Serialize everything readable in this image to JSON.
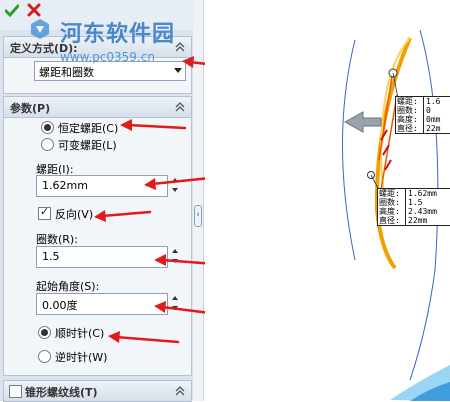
{
  "panel": {
    "definition_group": {
      "title": "定义方式(D):",
      "selected": "螺距和圈数"
    },
    "params_group": {
      "title": "参数(P)",
      "constant_pitch_label": "恒定螺距(C)",
      "variable_pitch_label": "可变螺距(L)",
      "pitch_label": "螺距(I):",
      "pitch_value": "1.62mm",
      "reverse_label": "反向(V)",
      "revolutions_label": "圈数(R):",
      "revolutions_value": "1.5",
      "start_angle_label": "起始角度(S):",
      "start_angle_value": "0.00度",
      "clockwise_label": "顺时针(C)",
      "counterclockwise_label": "逆时针(W)"
    },
    "taper_group": {
      "title": "锥形螺纹线(T)"
    }
  },
  "watermark": {
    "name": "河东软件园",
    "url": "www.pc0359.cn"
  },
  "viewport": {
    "callout_top": {
      "rows": [
        {
          "k": "螺距:",
          "v": "1.6"
        },
        {
          "k": "圈数:",
          "v": "0"
        },
        {
          "k": "高度:",
          "v": "0mm"
        },
        {
          "k": "直径:",
          "v": "22m"
        }
      ]
    },
    "callout_bottom": {
      "rows": [
        {
          "k": "螺距:",
          "v": "1.62mm"
        },
        {
          "k": "圈数:",
          "v": "1.5"
        },
        {
          "k": "高度:",
          "v": "2.43mm"
        },
        {
          "k": "直径:",
          "v": "22mm"
        }
      ]
    }
  },
  "colors": {
    "annotation_arrow": "#e01b1b",
    "helix": "#f0a000",
    "watermark": "#2f77c4"
  }
}
